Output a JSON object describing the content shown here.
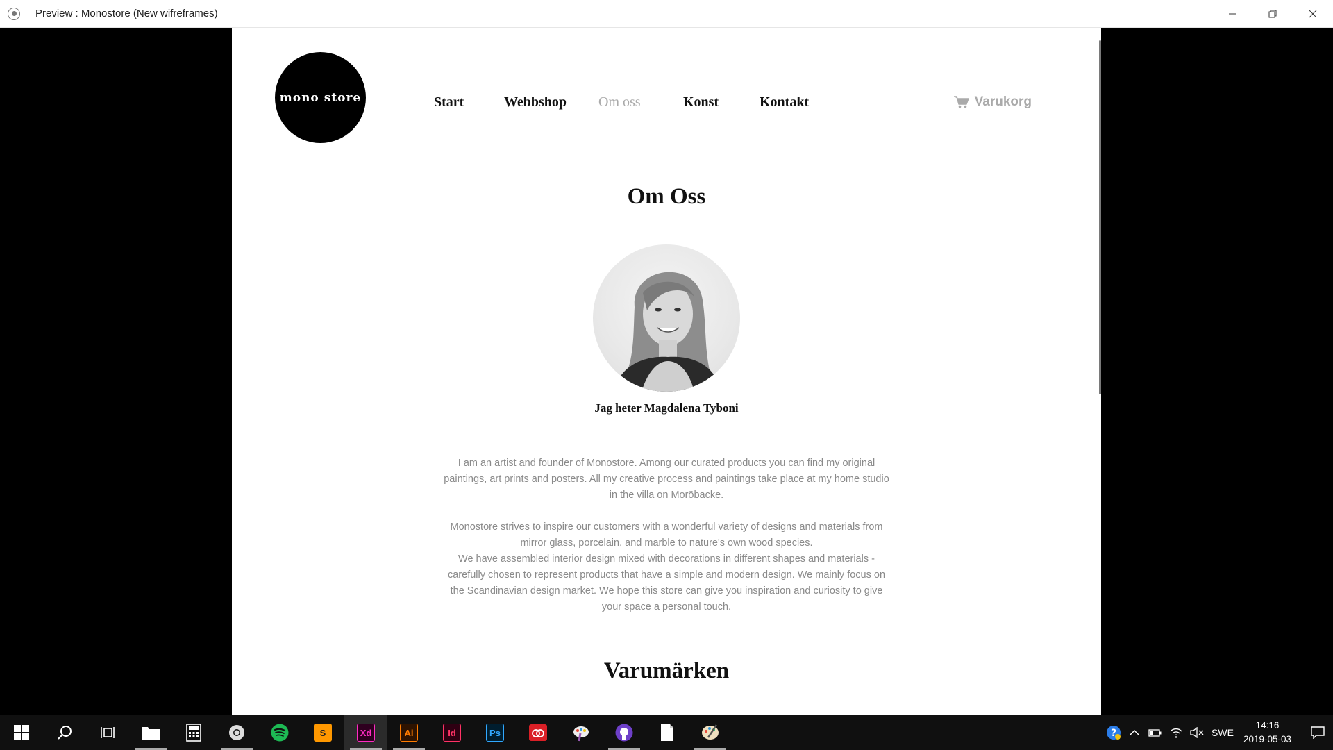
{
  "window": {
    "title": "Preview : Monostore (New wifreframes)",
    "minimize_icon": "minimize-icon",
    "maximize_icon": "restore-icon",
    "close_icon": "close-icon"
  },
  "site": {
    "logo_text": "mono store",
    "nav": [
      {
        "label": "Start",
        "active": false
      },
      {
        "label": "Webbshop",
        "active": false
      },
      {
        "label": "Om oss",
        "active": true
      },
      {
        "label": "Konst",
        "active": false
      },
      {
        "label": "Kontakt",
        "active": false
      }
    ],
    "cart_label": "Varukorg",
    "cart_icon": "shopping-cart-icon"
  },
  "content": {
    "section_title": "Om Oss",
    "portrait_icon": "portrait-photo",
    "name": "Jag heter Magdalena Tyboni",
    "bio_1": "I am an artist and founder of Monostore. Among our curated products you can find my original paintings, art prints and posters. All my creative process and paintings take place at my home studio in the villa on Moröbacke.",
    "bio_2": "Monostore strives to inspire our customers with a wonderful variety of designs and materials from mirror glass, porcelain, and marble to nature's own wood species.",
    "bio_3": "We have assembled interior design mixed with decorations in different shapes and materials -carefully chosen to represent products that have a simple and modern design. We mainly focus on the Scandinavian design market. We hope this store can give you inspiration and curiosity to give your space a personal touch.",
    "brands_title": "Varumärken"
  },
  "taskbar": {
    "apps": [
      {
        "name": "start-icon",
        "label": ""
      },
      {
        "name": "search-icon",
        "label": ""
      },
      {
        "name": "task-view-icon",
        "label": ""
      },
      {
        "name": "file-explorer-icon",
        "label": ""
      },
      {
        "name": "calculator-icon",
        "label": ""
      },
      {
        "name": "chrome-icon",
        "label": ""
      },
      {
        "name": "spotify-icon",
        "label": ""
      },
      {
        "name": "sublime-text-icon",
        "label": "S"
      },
      {
        "name": "adobe-xd-icon",
        "label": "Xd"
      },
      {
        "name": "adobe-illustrator-icon",
        "label": "Ai"
      },
      {
        "name": "adobe-indesign-icon",
        "label": "Id"
      },
      {
        "name": "adobe-photoshop-icon",
        "label": "Ps"
      },
      {
        "name": "creative-cloud-icon",
        "label": ""
      },
      {
        "name": "paint-3d-icon",
        "label": ""
      },
      {
        "name": "github-desktop-icon",
        "label": ""
      },
      {
        "name": "notepad-icon",
        "label": ""
      },
      {
        "name": "paint-icon",
        "label": ""
      }
    ],
    "tray": {
      "language": "SWE",
      "time": "14:16",
      "date": "2019-05-03"
    },
    "colors": {
      "xd": "#ff2bc2",
      "ai": "#ff7c00",
      "id": "#ff3366",
      "ps": "#31a8ff",
      "spotify": "#1db954",
      "sublime": "#ff9800",
      "cc": "#da1f26"
    }
  }
}
